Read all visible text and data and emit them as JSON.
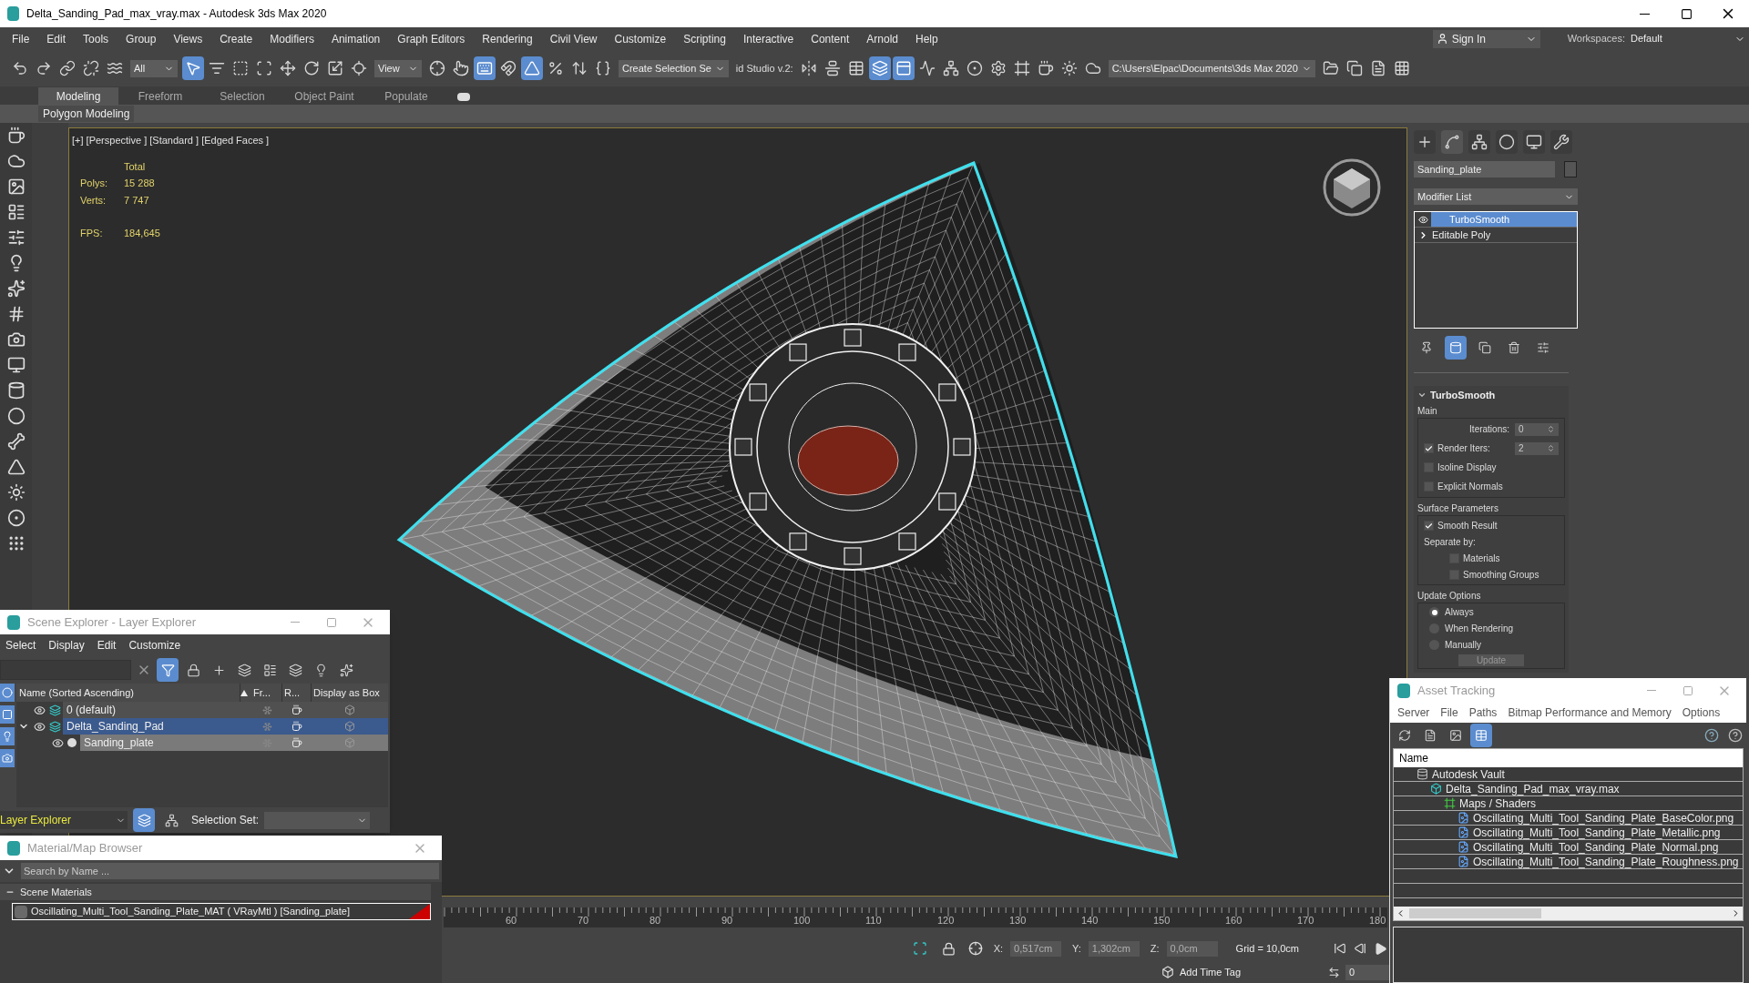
{
  "window": {
    "title": "Delta_Sanding_Pad_max_vray.max - Autodesk 3ds Max 2020"
  },
  "menu": [
    "File",
    "Edit",
    "Tools",
    "Group",
    "Views",
    "Create",
    "Modifiers",
    "Animation",
    "Graph Editors",
    "Rendering",
    "Civil View",
    "Customize",
    "Scripting",
    "Interactive",
    "Content",
    "Arnold",
    "Help"
  ],
  "account": {
    "sign_in": "Sign In",
    "workspaces_label": "Workspaces:",
    "workspace": "Default"
  },
  "toolbar": [
    {
      "kind": "tool",
      "selected": false
    },
    {
      "kind": "tool",
      "selected": false
    },
    {
      "kind": "tool",
      "selected": false
    },
    {
      "kind": "tool",
      "selected": false
    },
    {
      "kind": "tool",
      "selected": false
    },
    {
      "kind": "dropdown",
      "value": "All"
    },
    {
      "kind": "tool",
      "selected": true
    },
    {
      "kind": "tool",
      "selected": false
    },
    {
      "kind": "tool",
      "selected": false
    },
    {
      "kind": "tool",
      "selected": false
    },
    {
      "kind": "tool",
      "selected": false
    },
    {
      "kind": "tool",
      "selected": false
    },
    {
      "kind": "tool",
      "selected": false
    },
    {
      "kind": "tool",
      "selected": false
    },
    {
      "kind": "dropdown",
      "value": "View"
    },
    {
      "kind": "tool",
      "selected": false
    },
    {
      "kind": "tool",
      "selected": false
    },
    {
      "kind": "tool",
      "selected": true
    },
    {
      "kind": "tool",
      "selected": false
    },
    {
      "kind": "tool",
      "selected": true
    },
    {
      "kind": "tool",
      "selected": false
    },
    {
      "kind": "tool",
      "selected": false
    },
    {
      "kind": "tool",
      "selected": false
    },
    {
      "kind": "dropdown",
      "value": "Create Selection Se"
    },
    {
      "kind": "label",
      "value": "id Studio v.2:"
    },
    {
      "kind": "tool",
      "selected": false
    },
    {
      "kind": "tool",
      "selected": false
    },
    {
      "kind": "tool",
      "selected": false
    },
    {
      "kind": "tool",
      "selected": true
    },
    {
      "kind": "tool",
      "selected": true
    },
    {
      "kind": "tool",
      "selected": false
    },
    {
      "kind": "tool",
      "selected": false
    },
    {
      "kind": "tool",
      "selected": false
    },
    {
      "kind": "tool",
      "selected": false
    },
    {
      "kind": "tool",
      "selected": false
    },
    {
      "kind": "tool",
      "selected": false
    },
    {
      "kind": "tool",
      "selected": false
    },
    {
      "kind": "tool",
      "selected": false
    },
    {
      "kind": "dropdown",
      "value": "C:\\Users\\Elpac\\Documents\\3ds Max 2020"
    },
    {
      "kind": "tool",
      "selected": false
    },
    {
      "kind": "tool",
      "selected": false
    },
    {
      "kind": "tool",
      "selected": false
    },
    {
      "kind": "tool",
      "selected": false
    }
  ],
  "ribbon": {
    "tabs": [
      {
        "label": "Modeling",
        "selected": true
      },
      {
        "label": "Freeform",
        "selected": false
      },
      {
        "label": "Selection",
        "selected": false
      },
      {
        "label": "Object Paint",
        "selected": false
      },
      {
        "label": "Populate",
        "selected": false
      }
    ],
    "panel": "Polygon Modeling"
  },
  "viewport": {
    "label": "[+] [Perspective ] [Standard ] [Edged Faces ]",
    "stats_header": "Total",
    "stats": [
      {
        "label": "Polys:",
        "value": "15 288"
      },
      {
        "label": "Verts:",
        "value": "7 747"
      },
      {
        "label": "FPS:",
        "value": "184,645"
      }
    ]
  },
  "command_panel": {
    "tabs": [
      {
        "selected": false
      },
      {
        "selected": true
      },
      {
        "selected": false
      },
      {
        "selected": false
      },
      {
        "selected": false
      },
      {
        "selected": false
      }
    ],
    "object_name": "Sanding_plate",
    "modifier_list": "Modifier List",
    "stack": [
      {
        "label": "TurboSmooth",
        "kind": "modifier",
        "selected": true
      },
      {
        "label": "Editable Poly",
        "kind": "base",
        "selected": false
      }
    ],
    "stack_tools": [
      {
        "selected": false
      },
      {
        "selected": true
      },
      {
        "selected": false
      },
      {
        "selected": false
      },
      {
        "selected": false
      }
    ],
    "rollout": {
      "title": "TurboSmooth",
      "expanded": true,
      "main": {
        "title": "Main",
        "iterations": {
          "label": "Iterations:",
          "value": "0"
        },
        "render_iters": {
          "label": "Render Iters:",
          "value": "2",
          "checked": true
        },
        "options": [
          {
            "label": "Isoline Display",
            "checked": false
          },
          {
            "label": "Explicit Normals",
            "checked": false
          }
        ]
      },
      "surface": {
        "title": "Surface Parameters",
        "smooth_result": {
          "label": "Smooth Result",
          "checked": true
        },
        "separate_by": "Separate by:",
        "separate": [
          {
            "label": "Materials",
            "checked": false
          },
          {
            "label": "Smoothing Groups",
            "checked": false
          }
        ]
      },
      "update": {
        "title": "Update Options",
        "modes": [
          {
            "label": "Always",
            "selected": true
          },
          {
            "label": "When Rendering",
            "selected": false
          },
          {
            "label": "Manually",
            "selected": false
          }
        ],
        "button": "Update"
      }
    }
  },
  "scene_explorer": {
    "title": "Scene Explorer - Layer Explorer",
    "menu": [
      "Select",
      "Display",
      "Edit",
      "Customize"
    ],
    "tools": [
      {
        "selected": true
      },
      {
        "selected": false
      },
      {
        "selected": false
      },
      {
        "selected": false
      },
      {
        "selected": false
      },
      {
        "selected": false
      },
      {
        "selected": false
      },
      {
        "selected": false
      }
    ],
    "side_filters": [
      {
        "selected": true
      },
      {
        "selected": true
      },
      {
        "selected": true
      },
      {
        "selected": true
      }
    ],
    "columns": [
      "Name (Sorted Ascending)",
      "Fr...",
      "R...",
      "Display as Box"
    ],
    "tree": [
      {
        "name": "0 (default)",
        "kind": "layer",
        "selected": false
      },
      {
        "name": "Delta_Sanding_Pad",
        "kind": "layer",
        "selected": true,
        "expanded": true,
        "children": [
          {
            "name": "Sanding_plate",
            "kind": "object",
            "selected": true
          }
        ]
      }
    ],
    "explorer_mode": "Layer Explorer",
    "mode_tools": [
      {
        "selected": true
      },
      {
        "selected": false
      }
    ],
    "selection_set_label": "Selection Set:"
  },
  "material_browser": {
    "title": "Material/Map Browser",
    "search_placeholder": "Search by Name ...",
    "group": {
      "title": "Scene Materials",
      "expanded": true,
      "items": [
        "Oscillating_Multi_Tool_Sanding_Plate_MAT ( VRayMtl ) [Sanding_plate]"
      ]
    }
  },
  "asset_tracking": {
    "title": "Asset Tracking",
    "menu": [
      "Server",
      "File",
      "Paths",
      "Bitmap Performance and Memory",
      "Options"
    ],
    "tools": [
      {
        "selected": false
      },
      {
        "selected": false
      },
      {
        "selected": false
      },
      {
        "selected": true
      }
    ],
    "column": "Name",
    "tree": [
      {
        "name": "Autodesk Vault",
        "kind": "vault",
        "children": [
          {
            "name": "Delta_Sanding_Pad_max_vray.max",
            "kind": "scene",
            "children": [
              {
                "name": "Maps / Shaders",
                "kind": "folder",
                "children": [
                  {
                    "name": "Oscillating_Multi_Tool_Sanding_Plate_BaseColor.png",
                    "kind": "bitmap"
                  },
                  {
                    "name": "Oscillating_Multi_Tool_Sanding_Plate_Metallic.png",
                    "kind": "bitmap"
                  },
                  {
                    "name": "Oscillating_Multi_Tool_Sanding_Plate_Normal.png",
                    "kind": "bitmap"
                  },
                  {
                    "name": "Oscillating_Multi_Tool_Sanding_Plate_Roughness.png",
                    "kind": "bitmap"
                  }
                ]
              }
            ]
          }
        ]
      }
    ]
  },
  "timeline": {
    "ticks": [
      "60",
      "70",
      "80",
      "90",
      "100",
      "110",
      "120",
      "130",
      "140",
      "150",
      "160",
      "170",
      "180"
    ]
  },
  "status": {
    "coords": [
      {
        "label": "X:",
        "value": "0,517cm"
      },
      {
        "label": "Y:",
        "value": "1,302cm"
      },
      {
        "label": "Z:",
        "value": "0,0cm"
      }
    ],
    "grid": "Grid = 10,0cm",
    "time_tag": "Add Time Tag",
    "frame": "0"
  }
}
